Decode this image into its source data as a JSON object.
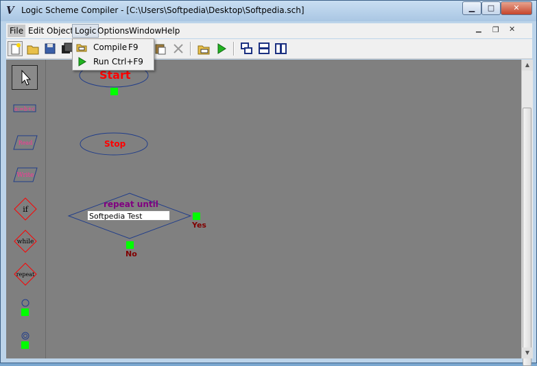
{
  "window": {
    "title": "Logic Scheme Compiler - [C:\\Users\\Softpedia\\Desktop\\Softpedia.sch]",
    "app_icon_glyph": "V",
    "minimize_glyph": "▁",
    "maximize_glyph": "□",
    "close_glyph": "✕",
    "mdi_minimize_glyph": "▁",
    "mdi_restore_glyph": "❐",
    "mdi_close_glyph": "✕"
  },
  "menu": {
    "items": [
      {
        "label": "File",
        "name": "menu-file"
      },
      {
        "label": "Edit",
        "name": "menu-edit"
      },
      {
        "label": "Object",
        "name": "menu-object"
      },
      {
        "label": "Logic",
        "name": "menu-logic"
      },
      {
        "label": "Options",
        "name": "menu-options"
      },
      {
        "label": "Window",
        "name": "menu-window"
      },
      {
        "label": "Help",
        "name": "menu-help"
      }
    ],
    "open_menu": "Logic"
  },
  "logic_menu": {
    "items": [
      {
        "label": "Compile",
        "shortcut": "F9",
        "icon": "compile-icon"
      },
      {
        "label": "Run",
        "shortcut": "Ctrl+F9",
        "icon": "run-icon"
      }
    ]
  },
  "toolbar": {
    "icons": [
      "new-icon",
      "open-icon",
      "save-icon",
      "save-all-icon",
      "paste-icon",
      "delete-icon",
      "compile-icon",
      "run-icon",
      "cascade-icon",
      "tile-horizontal-icon",
      "tile-vertical-icon"
    ]
  },
  "palette": {
    "items": [
      {
        "name": "pointer-tool",
        "icon": "pointer-icon"
      },
      {
        "name": "assign-block",
        "label": "a:=b+c"
      },
      {
        "name": "read-block",
        "label": "Read"
      },
      {
        "name": "write-block",
        "label": "Write"
      },
      {
        "name": "if-block",
        "label": "if"
      },
      {
        "name": "while-block",
        "label": "while"
      },
      {
        "name": "repeat-block",
        "label": "repeat"
      },
      {
        "name": "connector-block",
        "icon": "connector-icon"
      },
      {
        "name": "junction-block",
        "icon": "junction-icon"
      }
    ]
  },
  "canvas": {
    "start_label": "Start",
    "stop_label": "Stop",
    "repeat_label": "repeat until",
    "repeat_condition": "Softpedia Test",
    "yes_label": "Yes",
    "no_label": "No"
  },
  "colors": {
    "canvas_bg": "#808080",
    "block_outline": "#1f3c8a",
    "start_text": "#ff0000",
    "stop_text": "#ff0000",
    "repeat_text": "#800080",
    "branch_text": "#800000",
    "connector": "#00ff00",
    "diamond_outline": "#ff0000"
  }
}
